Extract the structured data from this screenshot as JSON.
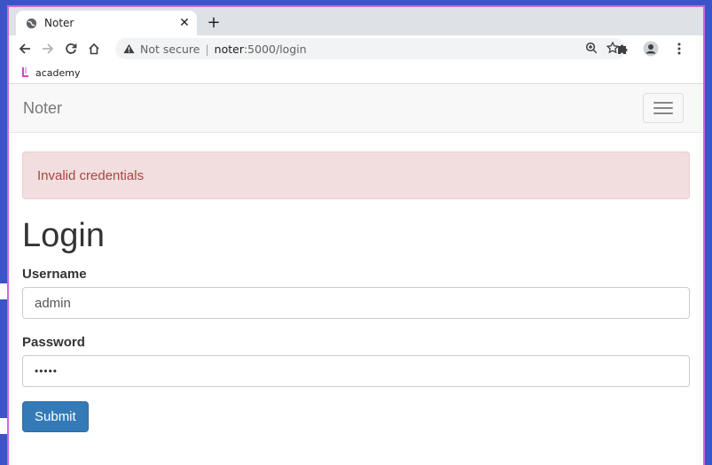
{
  "browser": {
    "tab_title": "Noter",
    "close_symbol": "✕",
    "new_tab_symbol": "+",
    "security_label": "Not secure",
    "url_host": "noter",
    "url_path": ":5000/login",
    "bookmark_label": "academy"
  },
  "navbar": {
    "brand": "Noter"
  },
  "alert": {
    "message": "Invalid credentials"
  },
  "page": {
    "heading": "Login"
  },
  "form": {
    "username_label": "Username",
    "username_value": "admin",
    "password_label": "Password",
    "password_value": "•••••",
    "submit_label": "Submit"
  },
  "colors": {
    "alert_bg": "#f2dede",
    "alert_text": "#a94442",
    "button_bg": "#337ab7",
    "window_border": "#c86ad8",
    "desktop_bg": "#3a55c8"
  }
}
